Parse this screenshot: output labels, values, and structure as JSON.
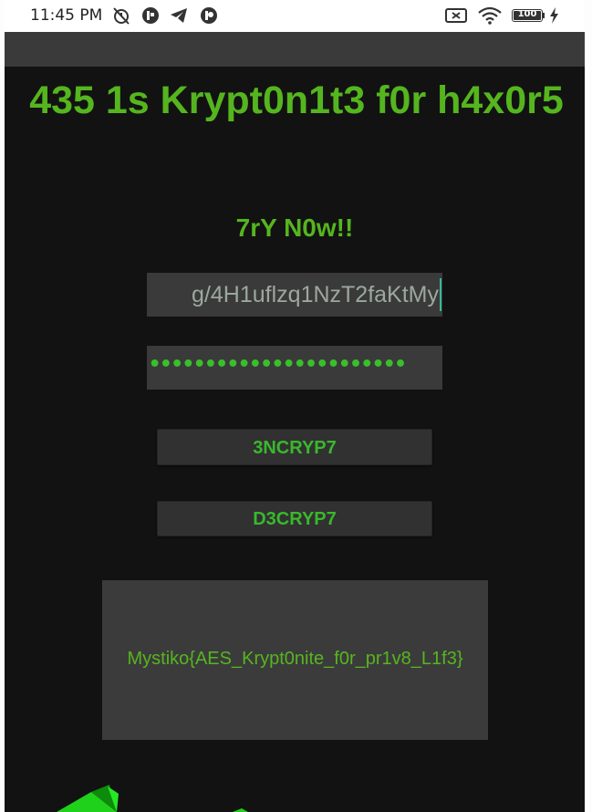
{
  "status_bar": {
    "time": "11:45 PM",
    "battery_level": "100",
    "icons": [
      "alarm-off-icon",
      "app-circle-icon",
      "telegram-icon",
      "app-circle-icon-2",
      "screen-cast-icon",
      "wifi-icon",
      "battery-icon",
      "charging-icon"
    ]
  },
  "main": {
    "title": "435 1s Krypt0n1t3 f0r h4x0r5",
    "subtitle": "7rY N0w!!",
    "key_input_value": "g/4H1uflzq1NzT2faKtMy",
    "password_mask": "•••••••••••••••••••••••",
    "encrypt_label": "3NCRYP7",
    "decrypt_label": "D3CRYP7",
    "output_text": "Mystiko{AES_Krypt0nite_f0r_pr1v8_L1f3}"
  },
  "colors": {
    "background": "#121212",
    "accent_green": "#55b51f",
    "button_text": "#39b82c",
    "field_bg": "#3a3a3a",
    "appbar_bg": "#3a3a3a"
  }
}
